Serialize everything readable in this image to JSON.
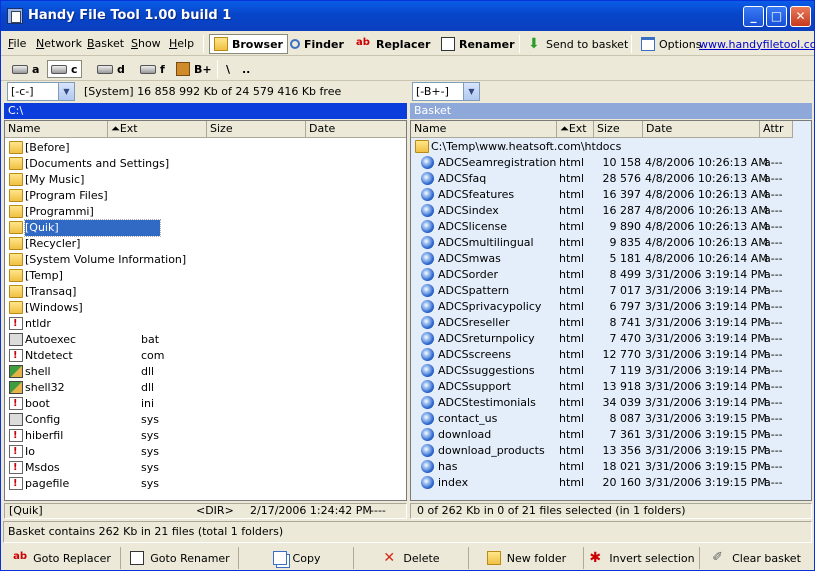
{
  "window": {
    "title": "Handy File Tool 1.00 build 1"
  },
  "menu": {
    "items": [
      {
        "label": "File",
        "u": "F",
        "rest": "ile"
      },
      {
        "label": "Network",
        "u": "N",
        "rest": "etwork"
      },
      {
        "label": "Basket",
        "u": "B",
        "rest": "asket"
      },
      {
        "label": "Show",
        "u": "S",
        "rest": "how"
      },
      {
        "label": "Help",
        "u": "H",
        "rest": "elp"
      }
    ],
    "tools": {
      "browser": "Browser",
      "finder": "Finder",
      "replacer": "Replacer",
      "renamer": "Renamer",
      "send_to_basket": "Send to basket",
      "options": "Options",
      "website": "www.handyfiletool.com"
    }
  },
  "drives": {
    "a": "a",
    "c": "c",
    "d": "d",
    "f": "f",
    "basket": "B+",
    "root": "\\",
    "up": ".."
  },
  "left": {
    "drive_combo": "[-c-]",
    "free_info": "[System] 16 858 992 Kb of 24 579 416 Kb free",
    "path": "C:\\",
    "columns": {
      "name": "Name",
      "ext": "Ext",
      "size": "Size",
      "date": "Date"
    },
    "rows": [
      {
        "name": "[Before]",
        "ext": "",
        "type": "folder"
      },
      {
        "name": "[Documents and Settings]",
        "ext": "",
        "type": "folder"
      },
      {
        "name": "[My Music]",
        "ext": "",
        "type": "folder"
      },
      {
        "name": "[Program Files]",
        "ext": "",
        "type": "folder"
      },
      {
        "name": "[Programmi]",
        "ext": "",
        "type": "folder"
      },
      {
        "name": "[Quik]",
        "ext": "",
        "type": "folder",
        "selected": true
      },
      {
        "name": "[Recycler]",
        "ext": "",
        "type": "folder"
      },
      {
        "name": "[System Volume Information]",
        "ext": "",
        "type": "folder"
      },
      {
        "name": "[Temp]",
        "ext": "",
        "type": "folder"
      },
      {
        "name": "[Transaq]",
        "ext": "",
        "type": "folder"
      },
      {
        "name": "[Windows]",
        "ext": "",
        "type": "folder"
      },
      {
        "name": "ntldr",
        "ext": "",
        "type": "file"
      },
      {
        "name": "Autoexec",
        "ext": "bat",
        "type": "cfg"
      },
      {
        "name": "Ntdetect",
        "ext": "com",
        "type": "file"
      },
      {
        "name": "shell",
        "ext": "dll",
        "type": "dll"
      },
      {
        "name": "shell32",
        "ext": "dll",
        "type": "dll"
      },
      {
        "name": "boot",
        "ext": "ini",
        "type": "file"
      },
      {
        "name": "Config",
        "ext": "sys",
        "type": "cfg"
      },
      {
        "name": "hiberfil",
        "ext": "sys",
        "type": "file"
      },
      {
        "name": "Io",
        "ext": "sys",
        "type": "file"
      },
      {
        "name": "Msdos",
        "ext": "sys",
        "type": "file"
      },
      {
        "name": "pagefile",
        "ext": "sys",
        "type": "file"
      }
    ]
  },
  "right": {
    "drive_combo": "[-B+-]",
    "path": "Basket",
    "columns": {
      "name": "Name",
      "ext": "Ext",
      "size": "Size",
      "date": "Date",
      "attr": "Attr"
    },
    "folder": "C:\\Temp\\www.heatsoft.com\\htdocs",
    "rows": [
      {
        "name": "ADCSeamregistration",
        "ext": "html",
        "size": "10 158",
        "date": "4/8/2006 10:26:13 AM",
        "attr": "a---"
      },
      {
        "name": "ADCSfaq",
        "ext": "html",
        "size": "28 576",
        "date": "4/8/2006 10:26:13 AM",
        "attr": "a---"
      },
      {
        "name": "ADCSfeatures",
        "ext": "html",
        "size": "16 397",
        "date": "4/8/2006 10:26:13 AM",
        "attr": "a---"
      },
      {
        "name": "ADCSindex",
        "ext": "html",
        "size": "16 287",
        "date": "4/8/2006 10:26:13 AM",
        "attr": "a---"
      },
      {
        "name": "ADCSlicense",
        "ext": "html",
        "size": "9 890",
        "date": "4/8/2006 10:26:13 AM",
        "attr": "a---"
      },
      {
        "name": "ADCSmultilingual",
        "ext": "html",
        "size": "9 835",
        "date": "4/8/2006 10:26:13 AM",
        "attr": "a---"
      },
      {
        "name": "ADCSmwas",
        "ext": "html",
        "size": "5 181",
        "date": "4/8/2006 10:26:14 AM",
        "attr": "a---"
      },
      {
        "name": "ADCSorder",
        "ext": "html",
        "size": "8 499",
        "date": "3/31/2006 3:19:14 PM",
        "attr": "a---"
      },
      {
        "name": "ADCSpattern",
        "ext": "html",
        "size": "7 017",
        "date": "3/31/2006 3:19:14 PM",
        "attr": "a---"
      },
      {
        "name": "ADCSprivacypolicy",
        "ext": "html",
        "size": "6 797",
        "date": "3/31/2006 3:19:14 PM",
        "attr": "a---"
      },
      {
        "name": "ADCSreseller",
        "ext": "html",
        "size": "8 741",
        "date": "3/31/2006 3:19:14 PM",
        "attr": "a---"
      },
      {
        "name": "ADCSreturnpolicy",
        "ext": "html",
        "size": "7 470",
        "date": "3/31/2006 3:19:14 PM",
        "attr": "a---"
      },
      {
        "name": "ADCSscreens",
        "ext": "html",
        "size": "12 770",
        "date": "3/31/2006 3:19:14 PM",
        "attr": "a---"
      },
      {
        "name": "ADCSsuggestions",
        "ext": "html",
        "size": "7 119",
        "date": "3/31/2006 3:19:14 PM",
        "attr": "a---"
      },
      {
        "name": "ADCSsupport",
        "ext": "html",
        "size": "13 918",
        "date": "3/31/2006 3:19:14 PM",
        "attr": "a---"
      },
      {
        "name": "ADCStestimonials",
        "ext": "html",
        "size": "34 039",
        "date": "3/31/2006 3:19:14 PM",
        "attr": "a---"
      },
      {
        "name": "contact_us",
        "ext": "html",
        "size": "8 087",
        "date": "3/31/2006 3:19:15 PM",
        "attr": "a---"
      },
      {
        "name": "download",
        "ext": "html",
        "size": "7 361",
        "date": "3/31/2006 3:19:15 PM",
        "attr": "a---"
      },
      {
        "name": "download_products",
        "ext": "html",
        "size": "13 356",
        "date": "3/31/2006 3:19:15 PM",
        "attr": "a---"
      },
      {
        "name": "has",
        "ext": "html",
        "size": "18 021",
        "date": "3/31/2006 3:19:15 PM",
        "attr": "a---"
      },
      {
        "name": "index",
        "ext": "html",
        "size": "20 160",
        "date": "3/31/2006 3:19:15 PM",
        "attr": "a---"
      }
    ]
  },
  "status": {
    "left_name": "[Quik]",
    "left_type": "<DIR>",
    "left_date": "2/17/2006 1:24:42 PM",
    "left_attr": "----",
    "right_info": "0 of 262 Kb in 0 of 21 files selected (in 1 folders)",
    "basket": "Basket contains 262 Kb in 21 files (total 1 folders)"
  },
  "actions": {
    "goto_replacer": "Goto Replacer",
    "goto_renamer": "Goto Renamer",
    "copy": "Copy",
    "delete": "Delete",
    "new_folder": "New folder",
    "invert_selection": "Invert selection",
    "clear_basket": "Clear basket"
  },
  "colors": {
    "left_title_active": "#0A3DDC",
    "right_title_inactive": "#8FA8DA",
    "selection": "#316AC5",
    "right_pane_bg": "#E4EEFA"
  }
}
